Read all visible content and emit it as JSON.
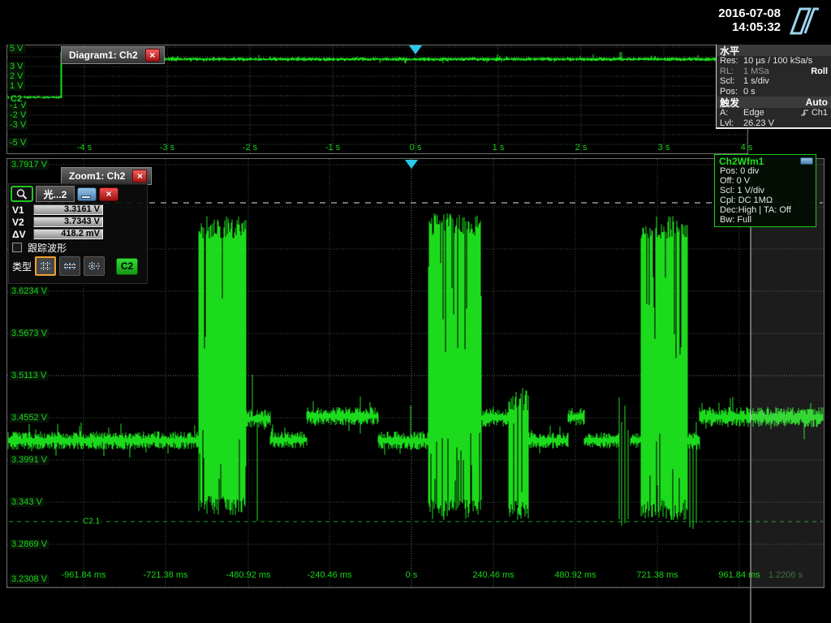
{
  "header": {
    "date": "2016-07-08",
    "time": "14:05:32"
  },
  "top_diagram": {
    "title": "Diagram1: Ch2",
    "channel_label": "C2",
    "v_labels": [
      "5 V",
      "3 V",
      "2 V",
      "1 V",
      "-1 V",
      "-2 V",
      "-3 V",
      "-5 V"
    ],
    "t_labels": [
      "-4 s",
      "-3 s",
      "-2 s",
      "-1 s",
      "0 s",
      "1 s",
      "2 s",
      "3 s",
      "4 s"
    ]
  },
  "horizontal_panel": {
    "title": "水平",
    "res_label": "Res:",
    "res_value": "10 µs / 100 kSa/s",
    "rl_label": "RL:",
    "rl_value": "1 MSa",
    "mode": "Roll",
    "scl_label": "Scl:",
    "scl_value": "1 s/div",
    "pos_label": "Pos:",
    "pos_value": "0 s"
  },
  "trigger_panel": {
    "title": "触发",
    "mode": "Auto",
    "a_label": "A:",
    "a_type": "Edge",
    "a_source": "Ch1",
    "lvl_label": "Lvl:",
    "lvl_value": "26.23 V"
  },
  "zoom_window": {
    "title": "Zoom1: Ch2",
    "ref_label": "C2.1",
    "right_time": "1.2206 s",
    "v_labels": [
      "3.7917 V",
      "3.6234 V",
      "3.5673 V",
      "3.5113 V",
      "3.4552 V",
      "3.3991 V",
      "3.343 V",
      "3.2869 V",
      "3.2308 V"
    ],
    "t_labels": [
      "-961.84 ms",
      "-721.38 ms",
      "-480.92 ms",
      "-240.46 ms",
      "0 s",
      "240.46 ms",
      "480.92 ms",
      "721.38 ms",
      "961.84 ms"
    ]
  },
  "cursor_box": {
    "tab": "光...2",
    "v1_label": "V1",
    "v1_value": "3.3161 V",
    "v2_label": "V2",
    "v2_value": "3.7343 V",
    "dv_label": "ΔV",
    "dv_value": "418.2 mV",
    "track_label": "跟踪波形",
    "type_label": "类型",
    "channel_button": "C2"
  },
  "wfm_panel": {
    "title": "Ch2Wfm1",
    "rows": [
      "Pos: 0 div",
      "Off: 0 V",
      "Scl: 1 V/div",
      "Cpl: DC 1MΩ",
      "Dec:High | TA: Off",
      "Bw: Full"
    ]
  },
  "colors": {
    "trace": "#1de61d",
    "grid": "#3a553a",
    "grid_center": "#5d7a5d",
    "cursor_white": "#f0f0f0",
    "cursor_green": "#18b818",
    "trigger_marker": "#29c9ef",
    "roll_line": "#e0e0e0"
  },
  "waveform": {
    "main": {
      "flats": [
        [
          10,
          245,
          543,
          9
        ],
        [
          303,
          333,
          516,
          9
        ],
        [
          333,
          378,
          542,
          8
        ],
        [
          378,
          466,
          513,
          9
        ],
        [
          466,
          528,
          543,
          9
        ],
        [
          593,
          626,
          515,
          9
        ],
        [
          651,
          700,
          543,
          8
        ],
        [
          700,
          720,
          514,
          9
        ],
        [
          720,
          762,
          543,
          8
        ],
        [
          777,
          790,
          543,
          8
        ],
        [
          847,
          862,
          544,
          10
        ],
        [
          862,
          1014,
          514,
          10
        ]
      ],
      "bursts": [
        [
          245,
          303,
          266,
          636
        ],
        [
          528,
          593,
          263,
          641
        ],
        [
          627,
          651,
          478,
          641
        ],
        [
          790,
          847,
          266,
          641
        ]
      ],
      "spikes": [
        [
          311,
          462,
          520
        ],
        [
          317,
          516,
          642
        ],
        [
          506,
          500,
          555
        ],
        [
          763,
          490,
          640
        ],
        [
          766,
          520,
          648
        ],
        [
          770,
          500,
          645
        ],
        [
          774,
          530,
          640
        ],
        [
          850,
          545,
          650
        ],
        [
          854,
          540,
          652
        ],
        [
          858,
          520,
          645
        ]
      ]
    },
    "top": {
      "flats": [
        [
          10,
          75,
          120,
          1.5
        ],
        [
          76,
          920,
          73,
          2
        ]
      ],
      "bursts": [],
      "spikes": [
        [
          75,
          64,
          121
        ],
        [
          76,
          64,
          121
        ],
        [
          613,
          67,
          74
        ],
        [
          731,
          67,
          74
        ],
        [
          764,
          64,
          75
        ],
        [
          766,
          64,
          75
        ],
        [
          860,
          68,
          74
        ]
      ]
    }
  }
}
